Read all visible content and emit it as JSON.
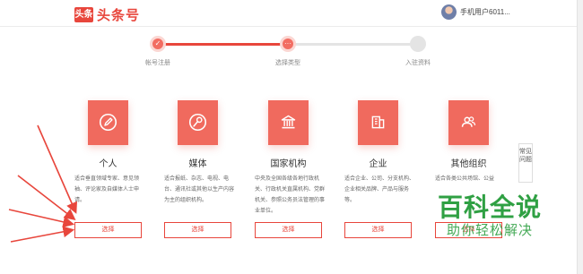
{
  "header": {
    "logo_badge": "头条",
    "logo_text": "头条号",
    "user_name": "手机用户6011..."
  },
  "steps": [
    {
      "label": "帐号注册",
      "status": "done",
      "glyph": "✓"
    },
    {
      "label": "选择类型",
      "status": "current",
      "glyph": "···"
    },
    {
      "label": "入驻资料",
      "status": "pending",
      "glyph": ""
    }
  ],
  "cards": [
    {
      "title": "个人",
      "icon": "pencil-icon",
      "desc": "适合垂直领域专家、意见领袖、评论家及自媒体人士申请。",
      "button": "选择"
    },
    {
      "title": "媒体",
      "icon": "microphone-icon",
      "desc": "适合报纸、杂志、电视、电台、通讯社或其他以生产内容为主的组织机构。",
      "button": "选择"
    },
    {
      "title": "国家机构",
      "icon": "government-building-icon",
      "desc": "中央及全国各级各地行政机关、行政机关直属机构、党群机关、参照公务员法管理的事业单位。",
      "button": "选择"
    },
    {
      "title": "企业",
      "icon": "office-building-icon",
      "desc": "适合企业、公司、分支机构、企业相关品牌、产品与服务等。",
      "button": "选择"
    },
    {
      "title": "其他组织",
      "icon": "group-icon",
      "desc": "适合各类公共场馆、公益",
      "button": "选择"
    }
  ],
  "side_tab": "常见问题",
  "watermark": {
    "title": "百科全说",
    "subtitle": "助你轻松解决"
  },
  "colors": {
    "accent": "#e8463c",
    "icon_bg": "#f06a5e",
    "watermark": "#2fa043",
    "arrow": "#e8463c"
  }
}
